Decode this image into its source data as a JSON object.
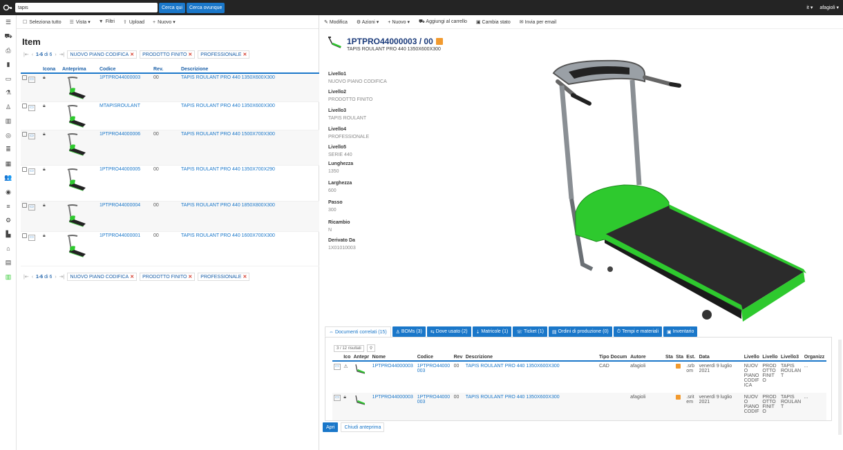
{
  "topbar": {
    "search_value": "tapis",
    "search_here": "Cerca qui",
    "search_everywhere": "Cerca ovunque",
    "lang": "it ▾",
    "user": "afagioli ▾"
  },
  "left": {
    "toolbar": {
      "select_all": "Seleziona tutto",
      "view": "Vista ▾",
      "filters": "Filtri",
      "upload": "Upload",
      "new": "Nuovo ▾"
    },
    "title": "Item",
    "pager": {
      "count": "1-6",
      "of": "di 6"
    },
    "chips": [
      "NUOVO PIANO CODIFICA",
      "PRODOTTO FINITO",
      "PROFESSIONALE"
    ],
    "columns": [
      "Icona",
      "Anteprima",
      "Codice",
      "Rev.",
      "Descrizione"
    ],
    "rows": [
      {
        "code": "1PTPRO44000003",
        "rev": "00",
        "desc": "TAPIS ROULANT PRO 440 1350X600X300"
      },
      {
        "code": "MTAPISROULANT",
        "rev": "",
        "desc": "TAPIS ROULANT PRO 440 1350X600X300"
      },
      {
        "code": "1PTPRO44000006",
        "rev": "00",
        "desc": "TAPIS ROULANT PRO 440 1500X700X300"
      },
      {
        "code": "1PTPRO44000005",
        "rev": "00",
        "desc": "TAPIS ROULANT PRO 440 1350X700X290"
      },
      {
        "code": "1PTPRO44000004",
        "rev": "00",
        "desc": "TAPIS ROULANT PRO 440 1850X800X300"
      },
      {
        "code": "1PTPRO44000001",
        "rev": "00",
        "desc": "TAPIS ROULANT PRO 440 1600X700X300"
      }
    ]
  },
  "right": {
    "toolbar": {
      "edit": "Modifica",
      "actions": "Azioni ▾",
      "new": "Nuovo ▾",
      "add_cart": "Aggiungi al carrello",
      "change_state": "Cambia stato",
      "email": "Invia per email"
    },
    "title": "1PTPRO44000003 / 00",
    "subtitle": "TAPIS ROULANT PRO 440 1350X600X300",
    "attributes": [
      {
        "k": "Livello1",
        "v": "NUOVO PIANO CODIFICA"
      },
      {
        "k": "Livello2",
        "v": "PRODOTTO FINITO"
      },
      {
        "k": "Livello3",
        "v": "TAPIS ROULANT"
      },
      {
        "k": "Livello4",
        "v": "PROFESSIONALE"
      },
      {
        "k": "Livello5",
        "v": "SERIE 440"
      },
      {
        "k": "Lunghezza",
        "v": "1350"
      },
      {
        "k": "Larghezza",
        "v": "600"
      },
      {
        "k": "Passo",
        "v": "300"
      },
      {
        "k": "Ricambio",
        "v": "N"
      },
      {
        "k": "Derivato Da",
        "v": "1X01010003"
      }
    ],
    "tabs": [
      "Documenti correlati (15)",
      "BOMs (3)",
      "Dove usato (2)",
      "Matricole (1)",
      "Ticket (1)",
      "Ordini di produzione (0)",
      "Tempi e materiali",
      "Inventario"
    ],
    "docs": {
      "results": "3 / 12 risultati",
      "columns": [
        "Ico",
        "Antepr",
        "Nome",
        "Codice",
        "Rev",
        "Descrizione",
        "Tipo Docum",
        "Autore",
        "Sta",
        "Sta",
        "Est.",
        "Data",
        "Livello",
        "Livello",
        "Livello3",
        "Organizz"
      ],
      "rows": [
        {
          "name": "1PTPRO44000003",
          "code": "1PTPRO44000 003",
          "rev": "00",
          "desc": "TAPIS ROULANT PRO 440 1350X600X300",
          "type": "CAD",
          "author": "afagioli",
          "ext": ".srb om",
          "date": "venerdì 9 luglio 2021",
          "l1": "NUOV O PIANO CODIF ICA",
          "l2": "PROD OTTO FINIT O",
          "l3": "TAPIS ROULAN T",
          "org": "..."
        },
        {
          "name": "1PTPRO44000003",
          "code": "1PTPRO44000 003",
          "rev": "00",
          "desc": "TAPIS ROULANT PRO 440 1350X600X300",
          "type": "",
          "author": "afagioli",
          "ext": ".srit em",
          "date": "venerdì 9 luglio 2021",
          "l1": "NUOV O PIANO CODIF",
          "l2": "PROD OTTO FINIT O",
          "l3": "TAPIS ROULAN T",
          "org": "..."
        }
      ]
    },
    "open": "Apri",
    "close_preview": "Chiudi anteprima"
  },
  "colors": {
    "accent": "#1a77c9",
    "topbar": "#242424",
    "green": "#2ec92e"
  },
  "sidebar_icons": [
    "menu-icon",
    "cart-icon",
    "printer-icon",
    "bookmark-icon",
    "folder-icon",
    "flask-icon",
    "hierarchy-icon",
    "building-icon",
    "headset-icon",
    "list-icon",
    "calendar-icon",
    "users-icon",
    "globe-icon",
    "list-settings-icon",
    "factory-gear-icon",
    "factory-icon",
    "tag-icon",
    "document-icon",
    "spreadsheet-icon"
  ]
}
